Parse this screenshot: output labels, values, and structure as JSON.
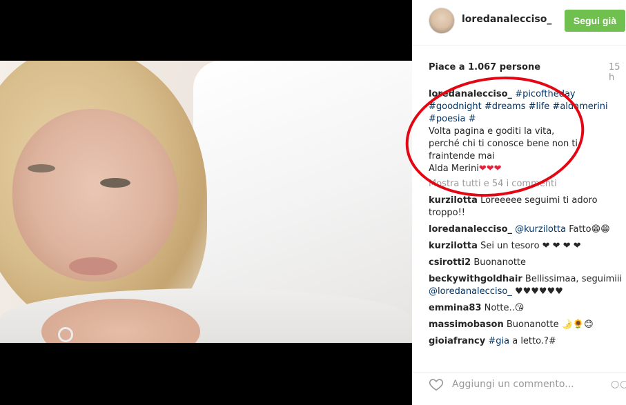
{
  "header": {
    "username": "loredanalecciso_",
    "follow_label": "Segui già"
  },
  "likes": {
    "text": "Piace a 1.067 persone",
    "time": "15 h"
  },
  "caption": {
    "user": "loredanalecciso_",
    "hashtags_line1": "#picoftheday",
    "hashtags_line2": "#goodnight #dreams #life #aldamerini",
    "hashtags_line3": "#poesia #",
    "line1": "Volta pagina e goditi la vita,",
    "line2": "perché chi ti conosce bene non ti",
    "line3": "fraintende mai",
    "line4": "Alda Merini",
    "hearts": "❤❤❤"
  },
  "show_all": "Mostra tutti e 54 i commenti",
  "comments": [
    {
      "user": "kurzilotta",
      "text": "Loreeeee seguimi ti adoro troppo!!"
    },
    {
      "user": "loredanalecciso_",
      "mention": "@kurzilotta",
      "text": "Fatto😁😁"
    },
    {
      "user": "kurzilotta",
      "text": "Sei un tesoro ❤ ❤ ❤ ❤"
    },
    {
      "user": "csirotti2",
      "text": "Buonanotte"
    },
    {
      "user": "beckywithgoldhair",
      "text": "Bellissimaa, seguimiii",
      "mention": "@loredanalecciso_",
      "tail": "♥♥♥♥♥♥"
    },
    {
      "user": "emmina83",
      "text": "Notte..😘"
    },
    {
      "user": "massimobason",
      "text": "Buonanotte 🌛🌻😊"
    },
    {
      "user": "gioiafrancy",
      "tag": "#gia",
      "text": "a letto.?#"
    }
  ],
  "footer": {
    "placeholder": "Aggiungi un commento...",
    "more": "○○○"
  }
}
